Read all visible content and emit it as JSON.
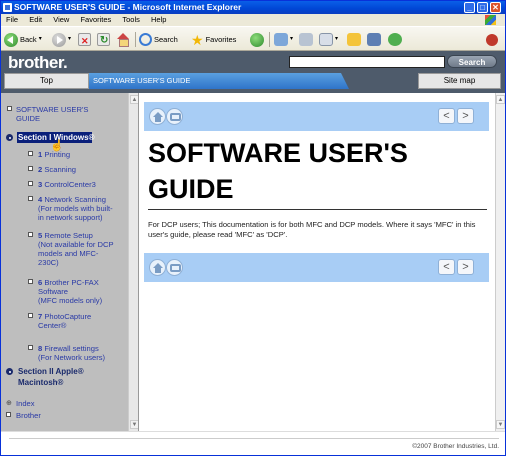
{
  "window": {
    "title": "SOFTWARE USER'S GUIDE - Microsoft Internet Explorer",
    "controls": {
      "minimize": "_",
      "maximize": "□",
      "close": "✕"
    }
  },
  "menu": [
    "File",
    "Edit",
    "View",
    "Favorites",
    "Tools",
    "Help"
  ],
  "toolbar": {
    "back": "Back",
    "search": "Search",
    "favorites": "Favorites"
  },
  "site": {
    "logo": "brother.",
    "search_value": "",
    "search_button": "Search",
    "tabs": {
      "top": "Top",
      "active": "SOFTWARE USER'S GUIDE",
      "sitemap": "Site map"
    }
  },
  "toc": {
    "guide": "SOFTWARE USER'S\nGUIDE",
    "section1": "Section I Windows®",
    "items": [
      {
        "num": "1",
        "label": "Printing"
      },
      {
        "num": "2",
        "label": "Scanning"
      },
      {
        "num": "3",
        "label": "ControlCenter3"
      },
      {
        "num": "4",
        "label": "Network Scanning\n(For models with built-\nin network support)"
      },
      {
        "num": "5",
        "label": "Remote Setup\n(Not available for DCP\nmodels and MFC-\n230C)"
      },
      {
        "num": "6",
        "label": "Brother PC-FAX\nSoftware\n(MFC models only)"
      },
      {
        "num": "7",
        "label": "PhotoCapture\nCenter®"
      },
      {
        "num": "8",
        "label": "Firewall settings\n(For Network users)"
      }
    ],
    "section2": "Section II Apple®\nMacintosh®",
    "index": "Index",
    "brother": "Brother"
  },
  "main": {
    "heading": "SOFTWARE USER'S\nGUIDE",
    "body": "For DCP users; This documentation is for both MFC and DCP models. Where it says 'MFC' in this user's guide, please read 'MFC' as 'DCP'.",
    "prev": "<",
    "next": ">"
  },
  "footer": {
    "copyright": "©2007 Brother Industries, Ltd."
  },
  "colors": {
    "navbar": "#4E5B6B",
    "tab_active": "#2F74C9",
    "band": "#A8CDF5",
    "sidebar": "#BEBEBE",
    "link": "#2A3AA6"
  }
}
